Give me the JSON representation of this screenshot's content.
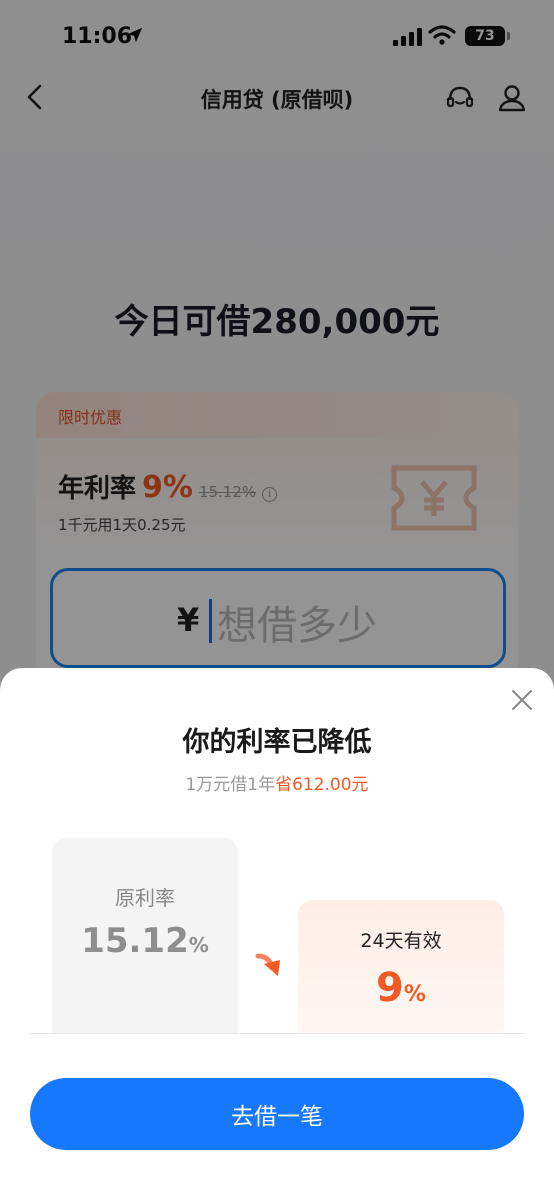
{
  "status_bar": {
    "time": "11:06",
    "battery": "73"
  },
  "nav": {
    "title": "信用贷 (原借呗)"
  },
  "quota": {
    "text": "今日可借280,000元"
  },
  "promo": {
    "tag": "限时优惠",
    "rate_label": "年利率",
    "rate_value": "9%",
    "rate_old": "15.12%",
    "rate_sub": "1千元用1天0.25元"
  },
  "amount_input": {
    "currency": "¥",
    "placeholder": "想借多少"
  },
  "sheet": {
    "title": "你的利率已降低",
    "subtitle_prefix": "1万元借1年",
    "subtitle_highlight": "省612.00元",
    "old_rate": {
      "label": "原利率",
      "value": "15.12",
      "unit": "%"
    },
    "new_rate": {
      "label": "24天有效",
      "value": "9",
      "unit": "%"
    },
    "cta_label": "去借一笔"
  },
  "colors": {
    "accent_blue": "#1677ff",
    "accent_orange": "#f15a24"
  }
}
